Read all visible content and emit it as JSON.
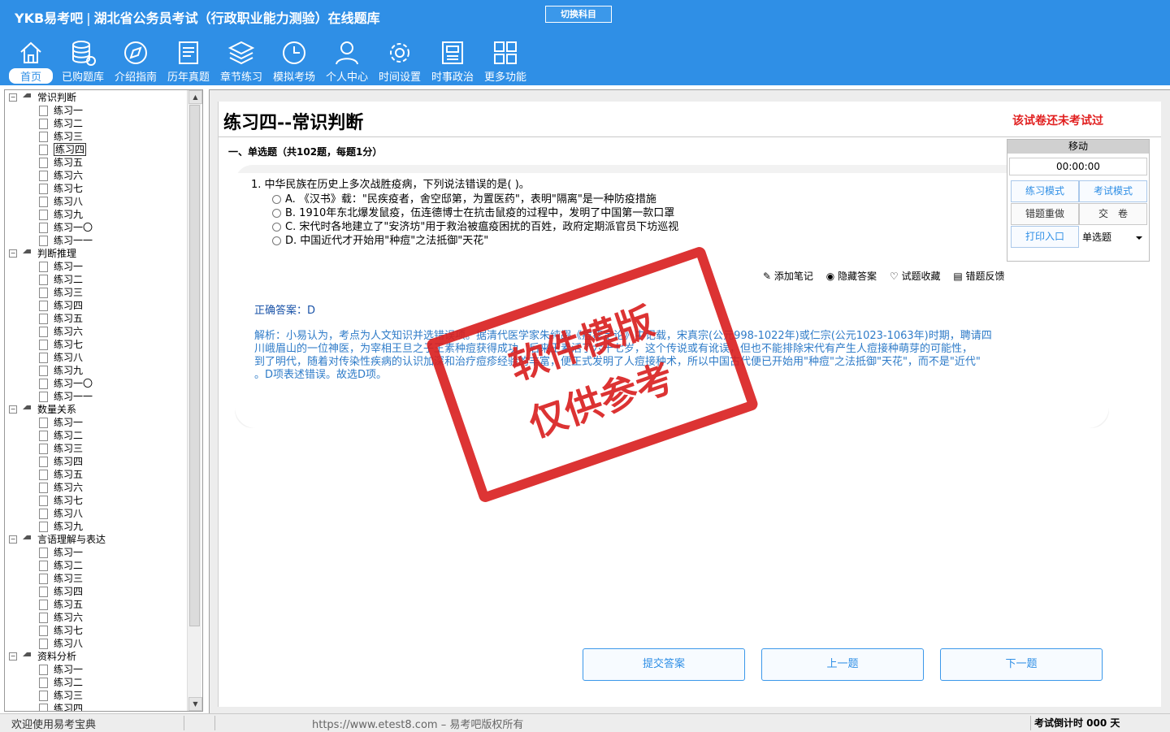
{
  "header": {
    "logo": "YKB易考吧",
    "subtitle": "湖北省公务员考试（行政职业能力测验）在线题库",
    "switch_label": "切换科目"
  },
  "nav": [
    {
      "label": "首页",
      "icon": "home-icon"
    },
    {
      "label": "已购题库",
      "icon": "database-icon"
    },
    {
      "label": "介绍指南",
      "icon": "compass-icon"
    },
    {
      "label": "历年真题",
      "icon": "document-list-icon"
    },
    {
      "label": "章节练习",
      "icon": "layers-icon"
    },
    {
      "label": "模拟考场",
      "icon": "clock-icon"
    },
    {
      "label": "个人中心",
      "icon": "user-icon"
    },
    {
      "label": "时间设置",
      "icon": "gear-icon"
    },
    {
      "label": "时事政治",
      "icon": "news-icon"
    },
    {
      "label": "更多功能",
      "icon": "grid-icon"
    }
  ],
  "tree": [
    {
      "label": "常识判断",
      "items": [
        "练习一",
        "练习二",
        "练习三",
        "练习四",
        "练习五",
        "练习六",
        "练习七",
        "练习八",
        "练习九",
        "练习一〇",
        "练习一一"
      ]
    },
    {
      "label": "判断推理",
      "items": [
        "练习一",
        "练习二",
        "练习三",
        "练习四",
        "练习五",
        "练习六",
        "练习七",
        "练习八",
        "练习九",
        "练习一〇",
        "练习一一"
      ]
    },
    {
      "label": "数量关系",
      "items": [
        "练习一",
        "练习二",
        "练习三",
        "练习四",
        "练习五",
        "练习六",
        "练习七",
        "练习八",
        "练习九"
      ]
    },
    {
      "label": "言语理解与表达",
      "items": [
        "练习一",
        "练习二",
        "练习三",
        "练习四",
        "练习五",
        "练习六",
        "练习七",
        "练习八"
      ]
    },
    {
      "label": "资料分析",
      "items": [
        "练习一",
        "练习二",
        "练习三",
        "练习四"
      ]
    }
  ],
  "exam": {
    "title": "练习四--常识判断",
    "status": "该试卷还未考试过",
    "section": "一、单选题（共102题，每题1分）",
    "question": "1. 中华民族在历史上多次战胜疫病，下列说法错误的是( )。",
    "options": [
      "A. 《汉书》载：\"民疾疫者，舍空邸第，为置医药\"，表明\"隔离\"是一种防疫措施",
      "B. 1910年东北爆发鼠疫，伍连德博士在抗击鼠疫的过程中，发明了中国第一款口罩",
      "C. 宋代时各地建立了\"安济坊\"用于救治被瘟疫困扰的百姓，政府定期派官员下坊巡视",
      "D. 中国近代才开始用\"种痘\"之法抵御\"天花\""
    ],
    "tools": [
      "添加笔记",
      "隐藏答案",
      "试题收藏",
      "错题反馈"
    ],
    "answer": "正确答案：D",
    "analysis_lines": [
      "解析：小易认为，考点为人文知识并选错误项。据清代医学家朱纯嘏《痘疹定论》中记载，宋真宗(公元998-1022年)或仁宗(公元1023-1063年)时期，聘请四",
      "川峨眉山的一位神医，为宰相王旦之子王素种痘获得成功，后来王素活了六十七岁，这个传说或有讹误，但也不能排除宋代有产生人痘接种萌芽的可能性，",
      "到了明代，随着对传染性疾病的认识加深和治疗痘疹经验的丰富，便正式发明了人痘接种术，所以中国古代便已开始用\"种痘\"之法抵御\"天花\"，而不是\"近代\"",
      "。D项表述错误。故选D项。"
    ]
  },
  "panel": {
    "move": "移动",
    "timer": "00:00:00",
    "practice_mode": "练习模式",
    "exam_mode": "考试模式",
    "redo_wrong": "错题重做",
    "submit_paper": "交　卷",
    "print": "打印入口",
    "type_select": "单选题"
  },
  "buttons": {
    "submit": "提交答案",
    "prev": "上一题",
    "next": "下一题"
  },
  "watermark": {
    "line1": "软件模版",
    "line2": "仅供参考"
  },
  "status": {
    "welcome": "欢迎使用易考宝典",
    "copyright": "https://www.etest8.com – 易考吧版权所有",
    "countdown": "考试倒计时 000 天"
  }
}
